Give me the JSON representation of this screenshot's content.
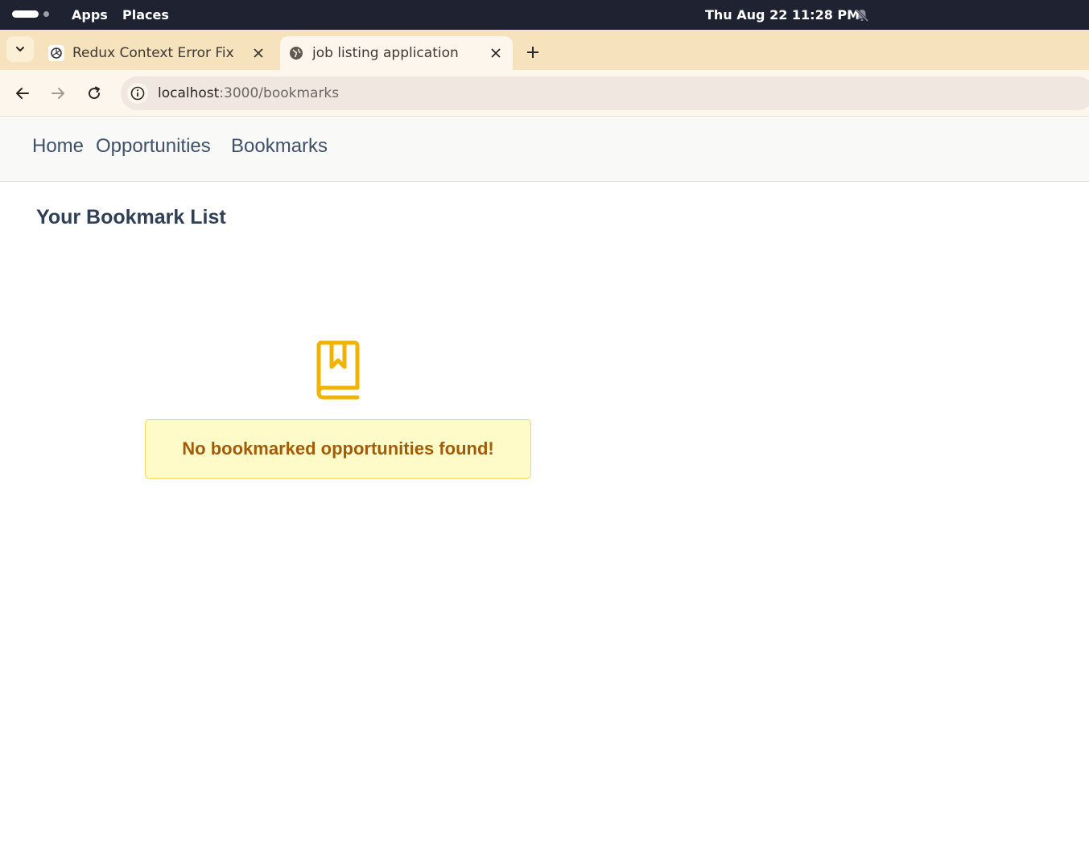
{
  "system": {
    "menu": [
      "Apps",
      "Places"
    ],
    "clock": "Thu Aug 22  11:28 PM",
    "icons": {
      "activities": "activities-indicator",
      "notifications": "bell-muted-icon"
    }
  },
  "browser": {
    "tabs": [
      {
        "title": "Redux Context Error Fix",
        "favicon": "openai-icon",
        "active": false
      },
      {
        "title": "job listing application",
        "favicon": "globe-icon",
        "active": true
      }
    ],
    "url": {
      "host": "localhost",
      "path": ":3000/bookmarks"
    }
  },
  "page": {
    "nav": [
      "Home",
      "Opportunities",
      "Bookmarks"
    ],
    "title": "Your Bookmark List",
    "empty_state": {
      "icon": "book-bookmark-icon",
      "message": "No bookmarked opportunities found!"
    }
  },
  "colors": {
    "accent": "#f0b400",
    "empty_bg": "#fefbc9",
    "empty_border": "#f5d66a",
    "empty_text": "#a15c07",
    "nav_text": "#3f5068"
  }
}
